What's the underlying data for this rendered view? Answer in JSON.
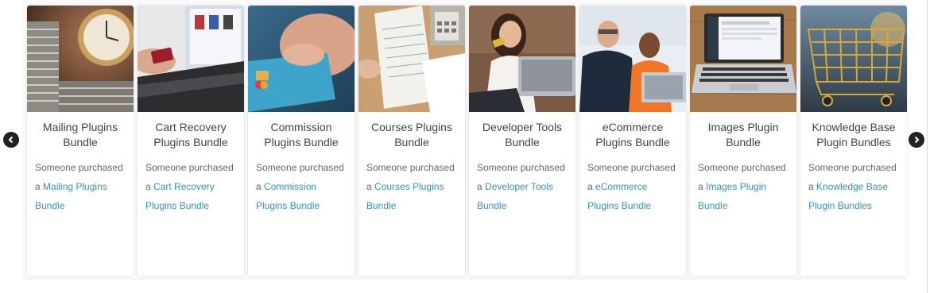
{
  "carousel": {
    "cards": [
      {
        "title": "Mailing Plugins Bundle",
        "lead": "Someone purchased a",
        "link": "Mailing Plugins Bundle",
        "image": "clock-and-coins-photo"
      },
      {
        "title": "Cart Recovery Plugins Bundle",
        "lead": "Someone purchased a",
        "link": "Cart Recovery Plugins Bundle",
        "image": "laptop-and-credit-card-photo"
      },
      {
        "title": "Commission Plugins Bundle",
        "lead": "Someone purchased a",
        "link": "Commission Plugins Bundle",
        "image": "hand-holding-credit-card-photo"
      },
      {
        "title": "Courses Plugins Bundle",
        "lead": "Someone purchased a",
        "link": "Courses Plugins Bundle",
        "image": "papers-and-calculator-photo"
      },
      {
        "title": "Developer Tools Bundle",
        "lead": "Someone purchased a",
        "link": "Developer Tools Bundle",
        "image": "woman-with-laptop-photo"
      },
      {
        "title": "eCommerce Plugins Bundle",
        "lead": "Someone purchased a",
        "link": "eCommerce Plugins Bundle",
        "image": "two-men-at-laptop-photo"
      },
      {
        "title": "Images Plugin Bundle",
        "lead": "Someone purchased a",
        "link": "Images Plugin Bundle",
        "image": "laptop-on-desk-photo"
      },
      {
        "title": "Knowledge Base Plugin Bundles",
        "lead": "Someone purchased a",
        "link": "Knowledge Base Plugin Bundles",
        "image": "shopping-cart-photo"
      }
    ],
    "prev_icon": "chevron-left-icon",
    "next_icon": "chevron-right-icon"
  },
  "colors": {
    "link": "#3a8fc4",
    "title": "#444444",
    "text": "#666666",
    "arrow": "#222222"
  }
}
